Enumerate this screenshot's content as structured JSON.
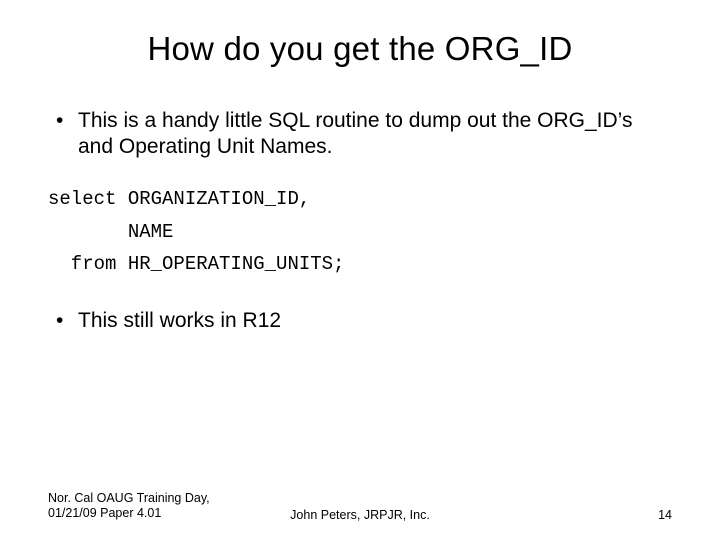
{
  "title": "How do you get the ORG_ID",
  "bullet1": "This is a handy little SQL routine to dump out the ORG_ID’s and Operating Unit Names.",
  "code": "select ORGANIZATION_ID,\n       NAME\n  from HR_OPERATING_UNITS;",
  "bullet2": "This still works in R12",
  "footer": {
    "left": "Nor. Cal OAUG Training Day, 01/21/09 Paper 4.01",
    "center": "John Peters, JRPJR, Inc.",
    "page": "14"
  }
}
